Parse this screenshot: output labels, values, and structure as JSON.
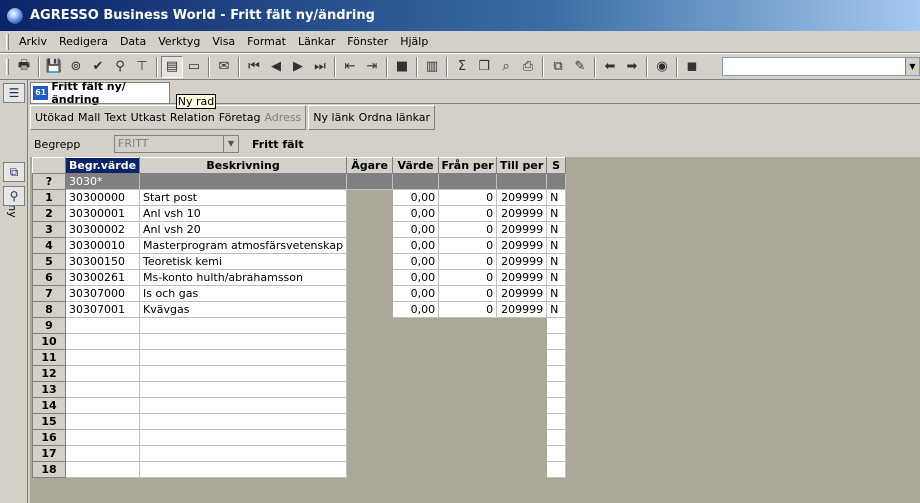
{
  "window": {
    "title": "AGRESSO Business World - Fritt fält ny/ändring"
  },
  "menu": [
    "Arkiv",
    "Redigera",
    "Data",
    "Verktyg",
    "Visa",
    "Format",
    "Länkar",
    "Fönster",
    "Hjälp"
  ],
  "sidebar": {
    "label": "Meny"
  },
  "tab": {
    "label": "Fritt fält ny/ändring",
    "icon_text": "61"
  },
  "tooltip": {
    "text": "Ny rad"
  },
  "subtoolbar": {
    "group1": [
      "Utökad",
      "Mall",
      "Text",
      "Utkast",
      "Relation",
      "Företag",
      "Adress"
    ],
    "group2": [
      "Ny länk",
      "Ordna länkar"
    ]
  },
  "filter": {
    "label": "Begrepp",
    "value": "FRITT",
    "description": "Fritt fält"
  },
  "grid": {
    "columns": [
      "Begr.värde",
      "Beskrivning",
      "Ägare",
      "Värde",
      "Från per",
      "Till per",
      "S"
    ],
    "new_row": {
      "marker": "?",
      "value": "3030*"
    },
    "rows": [
      {
        "n": "1",
        "code": "30300000",
        "desc": "Start post",
        "owner": "",
        "value": "0,00",
        "from": "0",
        "to": "209999",
        "s": "N"
      },
      {
        "n": "2",
        "code": "30300001",
        "desc": "Anl vsh 10",
        "owner": "",
        "value": "0,00",
        "from": "0",
        "to": "209999",
        "s": "N"
      },
      {
        "n": "3",
        "code": "30300002",
        "desc": "Anl vsh 20",
        "owner": "",
        "value": "0,00",
        "from": "0",
        "to": "209999",
        "s": "N"
      },
      {
        "n": "4",
        "code": "30300010",
        "desc": "Masterprogram atmosfärsvetenskap",
        "owner": "",
        "value": "0,00",
        "from": "0",
        "to": "209999",
        "s": "N"
      },
      {
        "n": "5",
        "code": "30300150",
        "desc": "Teoretisk kemi",
        "owner": "",
        "value": "0,00",
        "from": "0",
        "to": "209999",
        "s": "N"
      },
      {
        "n": "6",
        "code": "30300261",
        "desc": "Ms-konto hulth/abrahamsson",
        "owner": "",
        "value": "0,00",
        "from": "0",
        "to": "209999",
        "s": "N"
      },
      {
        "n": "7",
        "code": "30307000",
        "desc": "Is och gas",
        "owner": "",
        "value": "0,00",
        "from": "0",
        "to": "209999",
        "s": "N"
      },
      {
        "n": "8",
        "code": "30307001",
        "desc": "Kvävgas",
        "owner": "",
        "value": "0,00",
        "from": "0",
        "to": "209999",
        "s": "N"
      },
      {
        "n": "9",
        "code": "",
        "desc": "",
        "owner": "",
        "value": "",
        "from": "",
        "to": "",
        "s": ""
      },
      {
        "n": "10",
        "code": "",
        "desc": "",
        "owner": "",
        "value": "",
        "from": "",
        "to": "",
        "s": ""
      },
      {
        "n": "11",
        "code": "",
        "desc": "",
        "owner": "",
        "value": "",
        "from": "",
        "to": "",
        "s": ""
      },
      {
        "n": "12",
        "code": "",
        "desc": "",
        "owner": "",
        "value": "",
        "from": "",
        "to": "",
        "s": ""
      },
      {
        "n": "13",
        "code": "",
        "desc": "",
        "owner": "",
        "value": "",
        "from": "",
        "to": "",
        "s": ""
      },
      {
        "n": "14",
        "code": "",
        "desc": "",
        "owner": "",
        "value": "",
        "from": "",
        "to": "",
        "s": ""
      },
      {
        "n": "15",
        "code": "",
        "desc": "",
        "owner": "",
        "value": "",
        "from": "",
        "to": "",
        "s": ""
      },
      {
        "n": "16",
        "code": "",
        "desc": "",
        "owner": "",
        "value": "",
        "from": "",
        "to": "",
        "s": ""
      },
      {
        "n": "17",
        "code": "",
        "desc": "",
        "owner": "",
        "value": "",
        "from": "",
        "to": "",
        "s": ""
      },
      {
        "n": "18",
        "code": "",
        "desc": "",
        "owner": "",
        "value": "",
        "from": "",
        "to": "",
        "s": ""
      }
    ]
  },
  "toolbar_icons": [
    "print-icon",
    "save-icon",
    "binoculars-icon",
    "check-icon",
    "search-icon",
    "filter-icon",
    "new-row-icon",
    "blank-icon",
    "comment-icon",
    "first-icon",
    "prev-icon",
    "next-icon",
    "last-icon",
    "copy-rows-icon",
    "paste-rows-icon",
    "stop-icon",
    "chart-icon",
    "sum-icon",
    "duplicate-icon",
    "zoom-icon",
    "printer-setup-icon",
    "window-icon",
    "crayons-icon",
    "back-icon",
    "forward-icon",
    "record-icon",
    "note-icon"
  ]
}
